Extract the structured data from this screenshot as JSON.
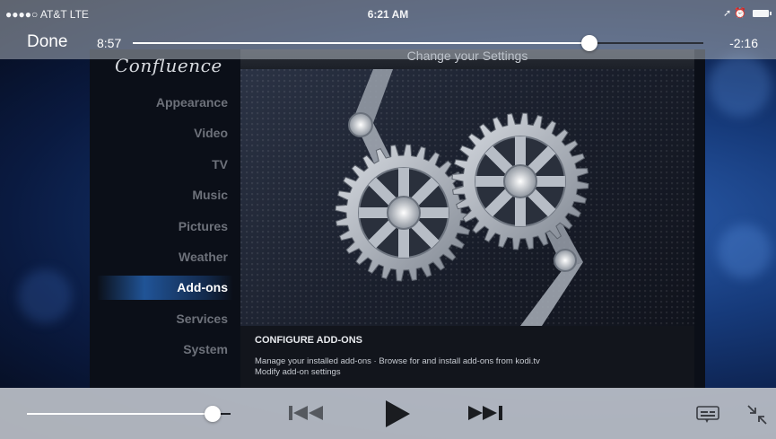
{
  "status_bar": {
    "carrier": "●●●●○ AT&T  LTE",
    "time": "6:21 AM"
  },
  "player": {
    "done_label": "Done",
    "elapsed": "8:57",
    "remaining": "-2:16",
    "progress_fraction": 0.8,
    "volume_fraction": 0.91
  },
  "kodi": {
    "logo": "Confluence",
    "header_title": "Change your Settings",
    "menu": [
      {
        "label": "Appearance"
      },
      {
        "label": "Video"
      },
      {
        "label": "TV"
      },
      {
        "label": "Music"
      },
      {
        "label": "Pictures"
      },
      {
        "label": "Weather"
      },
      {
        "label": "Add-ons",
        "selected": true
      },
      {
        "label": "Services"
      },
      {
        "label": "System"
      }
    ],
    "info_title": "CONFIGURE ADD-ONS",
    "info_line1": "Manage your installed add-ons · Browse for and install add-ons from kodi.tv",
    "info_line2": "Modify add-on settings"
  },
  "icons": {
    "previous": "previous-track-icon",
    "play": "play-icon",
    "next": "next-track-icon",
    "subtitles": "subtitles-icon",
    "exit_fullscreen": "exit-fullscreen-icon"
  }
}
